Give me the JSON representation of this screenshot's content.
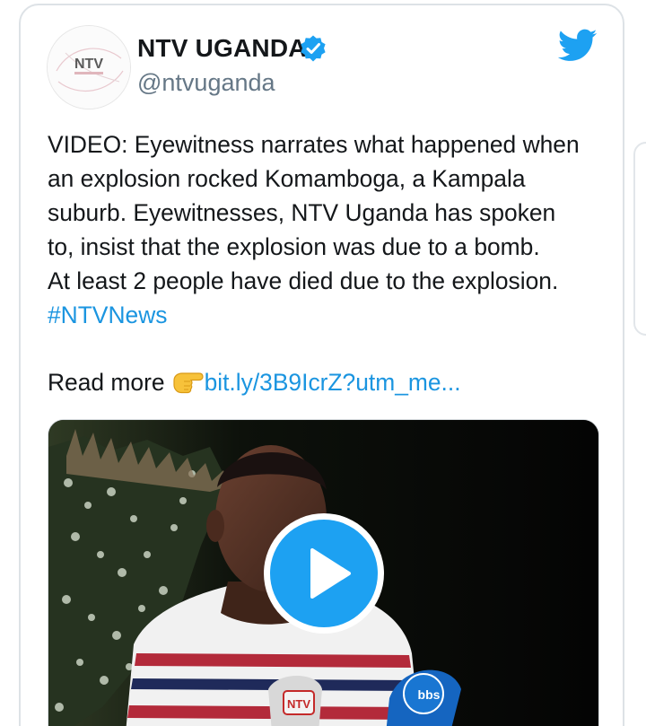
{
  "tweet": {
    "display_name": "NTV UGANDA",
    "handle": "@ntvuganda",
    "verified_icon": "verified-badge-icon",
    "platform_icon": "twitter-bird-icon",
    "avatar_logo_text": "NTV",
    "text_lines": [
      "VIDEO: Eyewitness narrates what happened when",
      "an explosion rocked Komamboga, a Kampala",
      "suburb. Eyewitnesses, NTV Uganda has spoken",
      "to, insist that the explosion was due to a bomb.",
      "At least 2 people have died due to the explosion."
    ],
    "hashtag": "#NTVNews",
    "read_more_label": "Read more",
    "read_more_emoji_icon": "pointing-hand-icon",
    "link_text": "bit.ly/3B9IcrZ?utm_me...",
    "media": {
      "type": "video",
      "play_icon": "play-icon",
      "mic_logo_1": "NTV",
      "mic_logo_2": "bbs"
    }
  },
  "colors": {
    "link": "#1b95e0",
    "twitter_blue": "#1da1f2",
    "text": "#14171a",
    "secondary_text": "#657786"
  }
}
